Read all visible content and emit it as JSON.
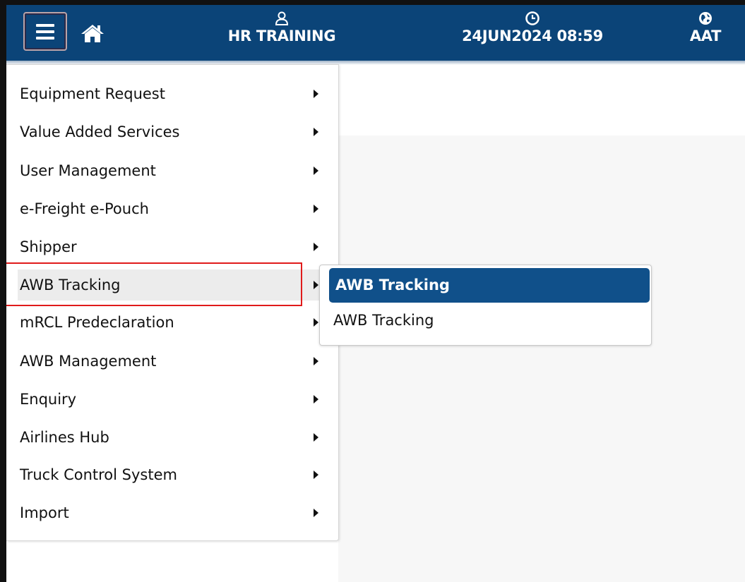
{
  "header": {
    "user_name": "HR TRAINING",
    "datetime": "24JUN2024 08:59",
    "region": "AAT",
    "colors": {
      "bar": "#0b4478",
      "text": "#ffffff"
    },
    "icons": [
      "menu-icon",
      "home-icon",
      "user-icon",
      "clock-icon",
      "globe-icon"
    ]
  },
  "menu": {
    "items": [
      {
        "label": "Equipment Request"
      },
      {
        "label": "Value Added Services"
      },
      {
        "label": "User Management"
      },
      {
        "label": "e-Freight e-Pouch"
      },
      {
        "label": "Shipper"
      },
      {
        "label": "AWB Tracking",
        "active": true
      },
      {
        "label": "mRCL Predeclaration"
      },
      {
        "label": "AWB Management"
      },
      {
        "label": "Enquiry"
      },
      {
        "label": "Airlines Hub"
      },
      {
        "label": "Truck Control System"
      },
      {
        "label": "Import"
      }
    ]
  },
  "submenu": {
    "header": "AWB Tracking",
    "items": [
      {
        "label": "AWB Tracking"
      }
    ],
    "colors": {
      "header_bg": "#10508a"
    }
  },
  "annotation": {
    "color": "#e01b1b"
  }
}
